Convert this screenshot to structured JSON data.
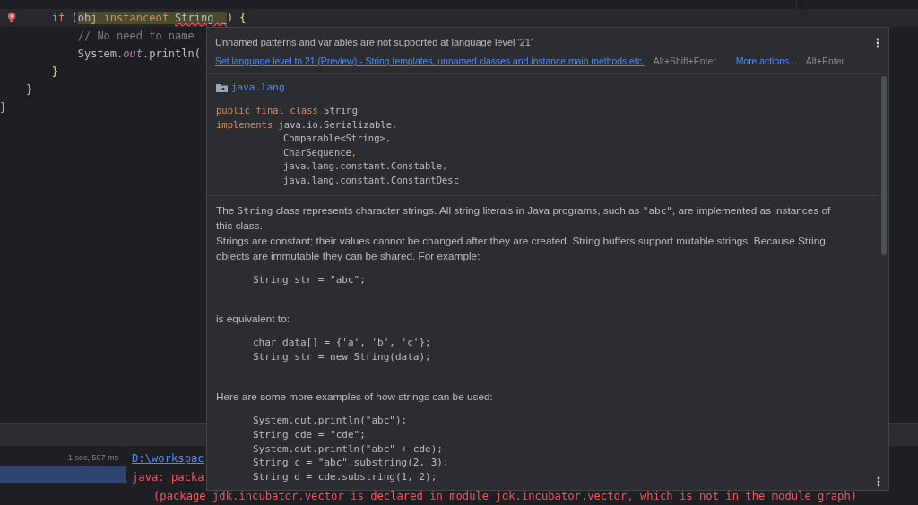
{
  "editor": {
    "lines": [
      {
        "current": true,
        "bulb": true,
        "tokens": [
          {
            "kind": "keyword",
            "text": "        if"
          },
          {
            "kind": "plain",
            "text": " ("
          },
          {
            "kind": "plain",
            "text": "obj ",
            "highlighted": true
          },
          {
            "kind": "keyword",
            "text": "instanceof ",
            "highlighted": true
          },
          {
            "kind": "plain",
            "text": "String _",
            "highlighted": true,
            "error": true
          },
          {
            "kind": "plain",
            "text": ") "
          },
          {
            "kind": "brace",
            "text": "{"
          }
        ]
      },
      {
        "current": false,
        "bulb": false,
        "tokens": [
          {
            "kind": "comment",
            "text": "            // No need to name"
          }
        ]
      },
      {
        "current": false,
        "bulb": false,
        "tokens": [
          {
            "kind": "plain",
            "text": "            System."
          },
          {
            "kind": "field",
            "text": "out"
          },
          {
            "kind": "plain",
            "text": ".println("
          }
        ]
      },
      {
        "current": false,
        "bulb": false,
        "tokens": [
          {
            "kind": "brace",
            "text": "        }"
          }
        ]
      },
      {
        "current": false,
        "bulb": false,
        "tokens": [
          {
            "kind": "plain",
            "text": "    }"
          }
        ]
      },
      {
        "current": false,
        "bulb": false,
        "tokens": [
          {
            "kind": "plain",
            "text": "}"
          }
        ]
      }
    ]
  },
  "run_panel": {
    "tree_rows": [
      {
        "time": "1 sec, 507 ms",
        "selected": false
      },
      {
        "selected": true
      }
    ],
    "console": [
      {
        "kind": "link",
        "text": "D:\\workspac"
      },
      {
        "kind": "error",
        "text": "java: packa"
      },
      {
        "kind": "error_indent",
        "text": "(package jdk.incubator.vector is declared in module jdk.incubator.vector, which is not in the module graph)"
      }
    ]
  },
  "popup": {
    "message": "Unnamed patterns and variables are not supported at language level '21'",
    "fix": {
      "label": "Set language level to 21 (Preview) - String templates, unnamed classes and instance main methods etc.",
      "shortcut": "Alt+Shift+Enter"
    },
    "more": {
      "label": "More actions...",
      "shortcut": "Alt+Enter"
    },
    "doc": {
      "package": "java.lang",
      "signature": [
        [
          {
            "kind": "keyword",
            "text": "public final class "
          },
          {
            "kind": "plain",
            "text": "String"
          }
        ],
        [
          {
            "kind": "keyword",
            "text": "implements "
          },
          {
            "kind": "plain",
            "text": "java.io.Serializable"
          },
          {
            "kind": "keyword",
            "text": ","
          }
        ],
        [
          {
            "kind": "pad"
          },
          {
            "kind": "plain",
            "text": "Comparable<String>"
          },
          {
            "kind": "keyword",
            "text": ","
          }
        ],
        [
          {
            "kind": "pad"
          },
          {
            "kind": "plain",
            "text": "CharSequence"
          },
          {
            "kind": "keyword",
            "text": ","
          }
        ],
        [
          {
            "kind": "pad"
          },
          {
            "kind": "plain",
            "text": "java.lang.constant.Constable"
          },
          {
            "kind": "keyword",
            "text": ","
          }
        ],
        [
          {
            "kind": "pad"
          },
          {
            "kind": "plain",
            "text": "java.lang.constant.ConstantDesc"
          }
        ]
      ],
      "blocks": [
        {
          "kind": "paragraph",
          "segments": [
            {
              "kind": "text",
              "text": "The "
            },
            {
              "kind": "code",
              "text": "String"
            },
            {
              "kind": "text",
              "text": " class represents character strings. All string literals in Java programs, such as "
            },
            {
              "kind": "code",
              "text": "\"abc\""
            },
            {
              "kind": "text",
              "text": ", are implemented as instances of this class."
            }
          ]
        },
        {
          "kind": "paragraph",
          "segments": [
            {
              "kind": "text",
              "text": "Strings are constant; their values cannot be changed after they are created. String buffers support mutable strings. Because String objects are immutable they can be shared. For example:"
            }
          ]
        },
        {
          "kind": "code",
          "lines": [
            "String str = \"abc\";"
          ]
        },
        {
          "kind": "paragraph",
          "segments": [
            {
              "kind": "text",
              "text": "is equivalent to:"
            }
          ]
        },
        {
          "kind": "code",
          "lines": [
            "char data[] = {'a', 'b', 'c'};",
            "String str = new String(data);"
          ]
        },
        {
          "kind": "paragraph",
          "segments": [
            {
              "kind": "text",
              "text": "Here are some more examples of how strings can be used:"
            }
          ]
        },
        {
          "kind": "code",
          "lines": [
            "System.out.println(\"abc\");",
            "String cde = \"cde\";",
            "System.out.println(\"abc\" + cde);",
            "String c = \"abc\".substring(2, 3);",
            "String d = cde.substring(1, 2);"
          ]
        }
      ]
    }
  }
}
